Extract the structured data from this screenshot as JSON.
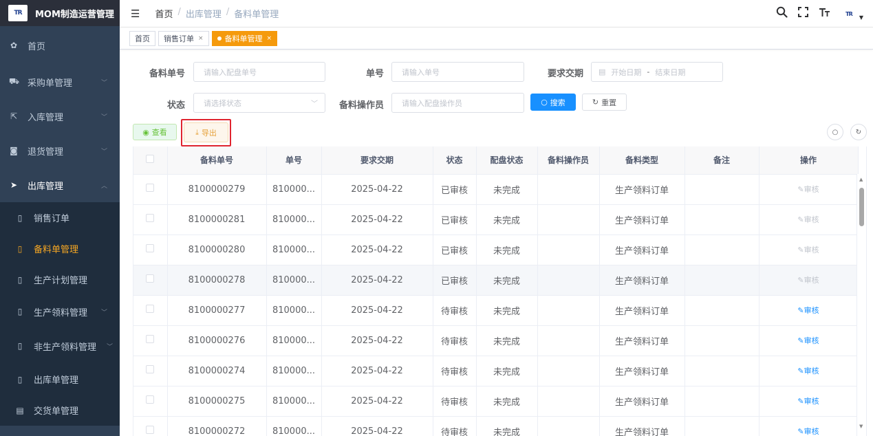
{
  "app": {
    "logo_text": "TR",
    "title": "MOM制造运营管理"
  },
  "sidebar": {
    "items": [
      {
        "label": "首页",
        "icon": "dashboard-icon",
        "glyph": "✿"
      },
      {
        "label": "采购单管理",
        "icon": "cart-icon",
        "glyph": "⛟"
      },
      {
        "label": "入库管理",
        "icon": "external-link-icon",
        "glyph": "⇱"
      },
      {
        "label": "退货管理",
        "icon": "return-icon",
        "glyph": "◙"
      },
      {
        "label": "出库管理",
        "icon": "send-icon",
        "glyph": "➤"
      }
    ],
    "sub_items": [
      {
        "label": "销售订单",
        "glyph": "▯"
      },
      {
        "label": "备料单管理",
        "glyph": "▯"
      },
      {
        "label": "生产计划管理",
        "glyph": "▯"
      },
      {
        "label": "生产领料管理",
        "glyph": "▯"
      },
      {
        "label": "非生产领料管理",
        "glyph": "▯"
      },
      {
        "label": "出库单管理",
        "glyph": "▯"
      },
      {
        "label": "交货单管理",
        "glyph": "▤"
      }
    ]
  },
  "breadcrumb": {
    "home": "首页",
    "sep": "/",
    "level1": "出库管理",
    "level2": "备料单管理"
  },
  "tags": {
    "home": "首页",
    "sales": "销售订单",
    "current": "备料单管理",
    "close": "×"
  },
  "form": {
    "prep_no_label": "备料单号",
    "prep_no_placeholder": "请输入配盘单号",
    "order_no_label": "单号",
    "order_no_placeholder": "请输入单号",
    "due_label": "要求交期",
    "start_placeholder": "开始日期",
    "range_sep": "-",
    "end_placeholder": "结束日期",
    "status_label": "状态",
    "status_placeholder": "请选择状态",
    "operator_label": "备料操作员",
    "operator_placeholder": "请输入配盘操作员",
    "search_label": "搜索",
    "reset_label": "重置"
  },
  "toolbar": {
    "view_label": "查看",
    "export_label": "导出"
  },
  "table": {
    "headers": [
      "备料单号",
      "单号",
      "要求交期",
      "状态",
      "配盘状态",
      "备料操作员",
      "备料类型",
      "备注",
      "操作"
    ],
    "action_label": "审核",
    "rows": [
      {
        "prep_no": "8100000279",
        "order_no": "810000...",
        "due": "2025-04-22",
        "status": "已审核",
        "match_status": "未完成",
        "operator": "",
        "type": "生产领料订单",
        "remark": "",
        "approve_enabled": false
      },
      {
        "prep_no": "8100000281",
        "order_no": "810000...",
        "due": "2025-04-22",
        "status": "已审核",
        "match_status": "未完成",
        "operator": "",
        "type": "生产领料订单",
        "remark": "",
        "approve_enabled": false
      },
      {
        "prep_no": "8100000280",
        "order_no": "810000...",
        "due": "2025-04-22",
        "status": "已审核",
        "match_status": "未完成",
        "operator": "",
        "type": "生产领料订单",
        "remark": "",
        "approve_enabled": false
      },
      {
        "prep_no": "8100000278",
        "order_no": "810000...",
        "due": "2025-04-22",
        "status": "已审核",
        "match_status": "未完成",
        "operator": "",
        "type": "生产领料订单",
        "remark": "",
        "approve_enabled": false
      },
      {
        "prep_no": "8100000277",
        "order_no": "810000...",
        "due": "2025-04-22",
        "status": "待审核",
        "match_status": "未完成",
        "operator": "",
        "type": "生产领料订单",
        "remark": "",
        "approve_enabled": true
      },
      {
        "prep_no": "8100000276",
        "order_no": "810000...",
        "due": "2025-04-22",
        "status": "待审核",
        "match_status": "未完成",
        "operator": "",
        "type": "生产领料订单",
        "remark": "",
        "approve_enabled": true
      },
      {
        "prep_no": "8100000274",
        "order_no": "810000...",
        "due": "2025-04-22",
        "status": "待审核",
        "match_status": "未完成",
        "operator": "",
        "type": "生产领料订单",
        "remark": "",
        "approve_enabled": true
      },
      {
        "prep_no": "8100000275",
        "order_no": "810000...",
        "due": "2025-04-22",
        "status": "待审核",
        "match_status": "未完成",
        "operator": "",
        "type": "生产领料订单",
        "remark": "",
        "approve_enabled": true
      },
      {
        "prep_no": "8100000272",
        "order_no": "810000...",
        "due": "2025-04-22",
        "status": "待审核",
        "match_status": "未完成",
        "operator": "",
        "type": "生产领料订单",
        "remark": "",
        "approve_enabled": true
      }
    ]
  },
  "colors": {
    "sidebar_bg": "#304156",
    "accent": "#f59a0c",
    "primary": "#1890ff",
    "highlight": "#e0242f"
  }
}
